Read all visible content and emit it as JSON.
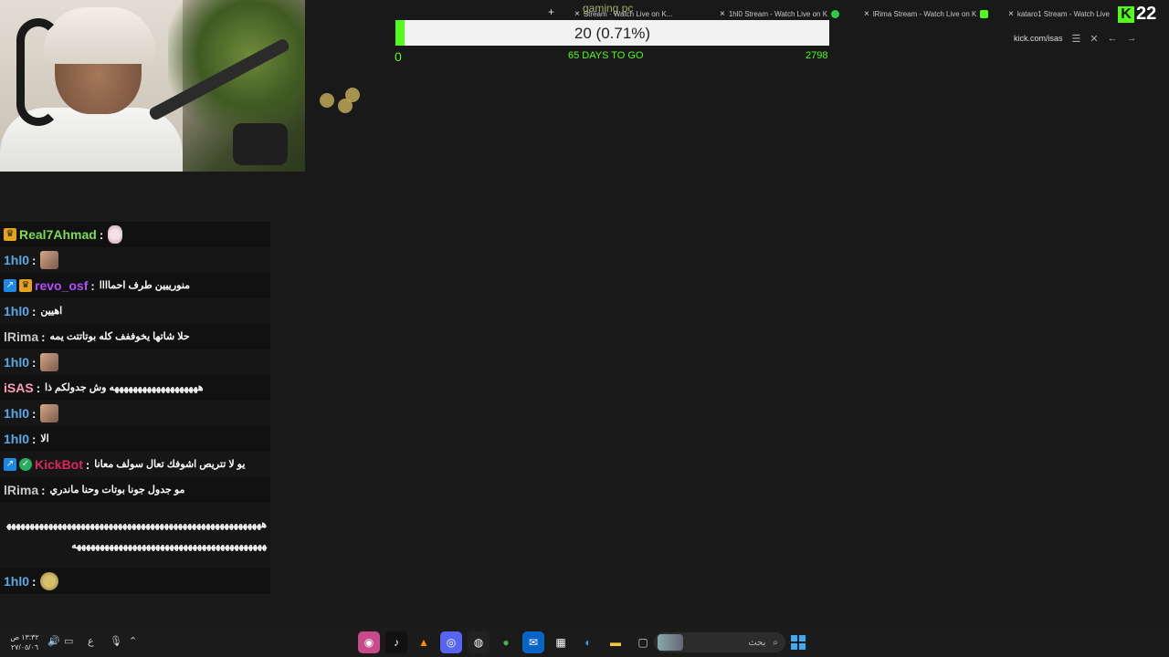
{
  "browser": {
    "overlay_title": "gaming pc",
    "tabs": [
      {
        "close": "×",
        "label": "Stream · Watch Live on K..."
      },
      {
        "close": "×",
        "label": "1hl0 Stream - Watch Live on K"
      },
      {
        "close": "×",
        "label": "lRima Stream - Watch Live on K"
      },
      {
        "close": "×",
        "label": "kataro1 Stream - Watch Live"
      }
    ],
    "new_tab": "+",
    "address": "kick.com/isas",
    "kick_count": "22"
  },
  "goal": {
    "label": "20 (0.71%)",
    "current": 20,
    "target": 2798,
    "min": "0",
    "days_left": "65 DAYS TO GO",
    "max": "2798",
    "progress_fraction": 0.0071,
    "accent": "#53fc18"
  },
  "chat": [
    {
      "user": "Real7Ahmad",
      "color": "#7ed957",
      "badges": [
        "crown"
      ],
      "text": "",
      "emote": "bunny"
    },
    {
      "user": "1hl0",
      "color": "#5aa9e6",
      "badges": [],
      "text": "",
      "emote": "img"
    },
    {
      "user": "revo_osf",
      "color": "#b44cff",
      "badges": [
        "arrow",
        "crown"
      ],
      "text": "منورييين طرف احماااا",
      "emote": ""
    },
    {
      "user": "1hl0",
      "color": "#5aa9e6",
      "badges": [],
      "text": "اهيين",
      "emote": ""
    },
    {
      "user": "lRima",
      "color": "#c9c9c9",
      "badges": [],
      "text": "حلا شاتها يخوففف كله بوتاتتت يمه",
      "emote": ""
    },
    {
      "user": "1hl0",
      "color": "#5aa9e6",
      "badges": [],
      "text": "",
      "emote": "img"
    },
    {
      "user": "iSAS",
      "color": "#ff9eb5",
      "badges": [],
      "text": "هههههههههههههههههههه وش جدولكم ذا",
      "emote": ""
    },
    {
      "user": "1hl0",
      "color": "#5aa9e6",
      "badges": [],
      "text": "",
      "emote": "img"
    },
    {
      "user": "1hl0",
      "color": "#5aa9e6",
      "badges": [],
      "text": "الا",
      "emote": ""
    },
    {
      "user": "KickBot",
      "color": "#e0245e",
      "badges": [
        "arrow",
        "check"
      ],
      "text": "يو لا تتريص اشوفك تعال سولف معانا",
      "emote": ""
    },
    {
      "user": "lRima",
      "color": "#c9c9c9",
      "badges": [],
      "text": "مو جدول جونا بوتات وحنا ماندري",
      "emote": ""
    },
    {
      "user": "",
      "color": "#ffffff",
      "badges": [],
      "text": "هههههههههههههههههههههههههههههههههههههههههههههههههههههههههههههههههههههههههههههههههههههههههههههههههه",
      "emote": ""
    },
    {
      "user": "1hl0",
      "color": "#5aa9e6",
      "badges": [],
      "text": "",
      "emote": "face"
    }
  ],
  "taskbar": {
    "clock_time": "١٣:٣٢ ص",
    "clock_date": "٢٧/٠٥/٠٦",
    "lang": "ع",
    "search_placeholder": "بحث",
    "apps": [
      "chrome-alt-icon",
      "tiktok-icon",
      "vlc-icon",
      "discord-icon",
      "obs-icon",
      "chrome-icon",
      "outlook-icon",
      "store-icon",
      "edge-icon",
      "explorer-icon",
      "window-icon"
    ]
  }
}
